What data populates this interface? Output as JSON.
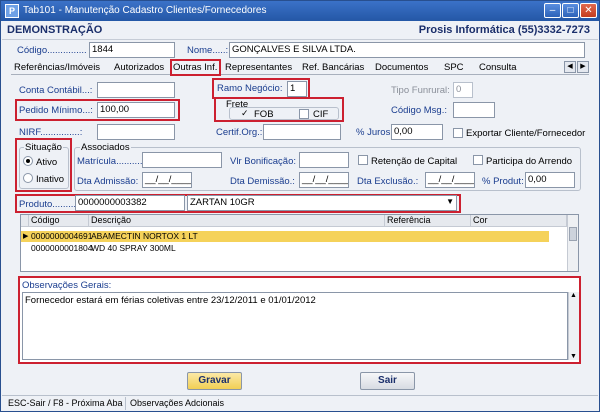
{
  "window": {
    "title": "Tab101 - Manutenção Cadastro Clientes/Fornecedores",
    "app_icon": "P",
    "controls": [
      "minimize-icon",
      "maximize-icon",
      "close-icon"
    ]
  },
  "header": {
    "company": "DEMONSTRAÇÃO",
    "vendor": "Prosis Informática (55)3332-7273"
  },
  "record": {
    "codigo_label": "Código...............",
    "codigo_value": "1844",
    "nome_label": "Nome.....:",
    "nome_value": "GONÇALVES E SILVA LTDA."
  },
  "tabs": [
    {
      "label": "Referências/Imóveis"
    },
    {
      "label": "Autorizados"
    },
    {
      "label": "Outras Inf."
    },
    {
      "label": "Representantes"
    },
    {
      "label": "Ref. Bancárias"
    },
    {
      "label": "Documentos"
    },
    {
      "label": "SPC"
    },
    {
      "label": "Consulta"
    }
  ],
  "form": {
    "conta_contabil_label": "Conta Contábil...:",
    "conta_contabil_value": "",
    "ramo_negocio_label": "Ramo Negócio:",
    "ramo_negocio_value": "1",
    "tipo_funrural_label": "Tipo Funrural:",
    "tipo_funrural_value": "0",
    "pedido_minimo_label": "Pedido Mínimo...:",
    "pedido_minimo_value": "100,00",
    "frete_label": "Frete",
    "fob_label": "FOB",
    "fob_checked": true,
    "cif_label": "CIF",
    "cif_checked": false,
    "codigo_msg_label": "Código Msg.:",
    "codigo_msg_value": "",
    "nirf_label": "NIRF...............:",
    "nirf_value": "",
    "certif_org_label": "Certif.Org.:",
    "certif_org_value": "",
    "juros_label": "% Juros:",
    "juros_value": "0,00",
    "exportar_label": "Exportar Cliente/Fornecedor",
    "situacao_label": "Situação",
    "ativo_label": "Ativo",
    "inativo_label": "Inativo",
    "situacao_selected": "Ativo",
    "associados_label": "Associados",
    "matricula_label": "Matrícula...........",
    "matricula_value": "",
    "vlr_bonificacao_label": "Vlr Bonificação:",
    "vlr_bonificacao_value": "",
    "retencao_label": "Retenção de Capital",
    "participa_label": "Participa do Arrendo",
    "dta_admissao_label": "Dta Admissão:",
    "dta_admissao_value": "__/__/____",
    "dta_demissao_label": "Dta Demissão.:",
    "dta_demissao_value": "__/__/____",
    "dta_exclusao_label": "Dta Exclusão.:",
    "dta_exclusao_value": "__/__/____",
    "produt_label": "% Produt:",
    "produt_value": "0,00",
    "produto_label": "Produto.........",
    "produto_code": "0000000003382",
    "produto_name": "ZARTAN 10GR"
  },
  "grid": {
    "columns": [
      "Código",
      "Descrição",
      "Referência",
      "Cor"
    ],
    "rows": [
      {
        "codigo": "0000000004691",
        "descricao": "ABAMECTIN NORTOX 1 LT",
        "selected": true
      },
      {
        "codigo": "0000000001804",
        "descricao": "WD 40 SPRAY 300ML",
        "selected": false
      }
    ]
  },
  "observacoes": {
    "label": "Observações Gerais:",
    "text": "Fornecedor estará em férias coletivas entre 23/12/2011 e 01/01/2012"
  },
  "buttons": {
    "gravar": "Gravar",
    "sair": "Sair"
  },
  "status": {
    "shortcuts": "ESC-Sair / F8 - Próxima Aba",
    "info": "Observações Adcionais"
  },
  "colors": {
    "highlight_red": "#cc2030",
    "row_selected": "#f5d25a",
    "title_blue": "#2457a6"
  }
}
